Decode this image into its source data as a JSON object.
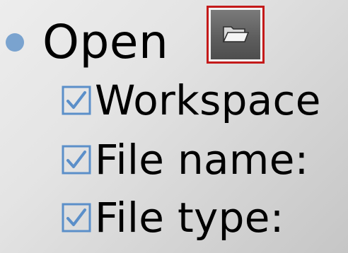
{
  "bullet": {
    "label": "Open",
    "button_icon": "folder-open-icon",
    "button_highlight_color": "#c41a1a"
  },
  "sub_items": [
    {
      "label": "Workspace",
      "checked": true,
      "icon": "checked-box-icon"
    },
    {
      "label": "File name:",
      "checked": true,
      "icon": "checked-box-icon"
    },
    {
      "label": "File type:",
      "checked": true,
      "icon": "checked-box-icon"
    }
  ],
  "colors": {
    "bullet": "#7aa3cf",
    "checkbox": "#5b8fc9",
    "text": "#000000"
  }
}
